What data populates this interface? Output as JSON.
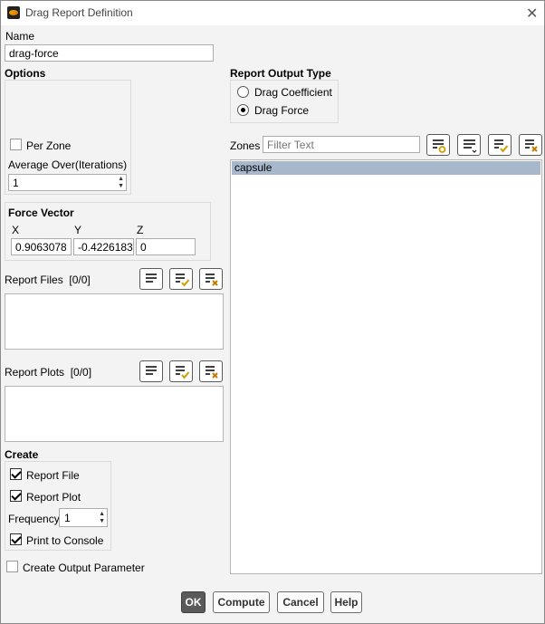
{
  "window": {
    "title": "Drag Report Definition"
  },
  "name": {
    "label": "Name",
    "value": "drag-force"
  },
  "options": {
    "heading": "Options",
    "per_zone": {
      "label": "Per Zone",
      "checked": false
    },
    "average_over": {
      "label": "Average Over(Iterations)",
      "value": "1"
    }
  },
  "force_vector": {
    "heading": "Force Vector",
    "x_label": "X",
    "y_label": "Y",
    "z_label": "Z",
    "x": "0.9063078",
    "y": "-0.4226183",
    "z": "0"
  },
  "report_files": {
    "label": "Report Files",
    "count": "[0/0]"
  },
  "report_plots": {
    "label": "Report Plots",
    "count": "[0/0]"
  },
  "create": {
    "heading": "Create",
    "report_file": {
      "label": "Report File",
      "checked": true
    },
    "report_plot": {
      "label": "Report Plot",
      "checked": true
    },
    "frequency": {
      "label": "Frequency",
      "value": "1"
    },
    "print_to_console": {
      "label": "Print to Console",
      "checked": true
    }
  },
  "create_output_parameter": {
    "label": "Create Output Parameter",
    "checked": false
  },
  "report_output_type": {
    "heading": "Report Output Type",
    "options": [
      "Drag Coefficient",
      "Drag Force"
    ],
    "selected": "Drag Force"
  },
  "zones": {
    "label": "Zones",
    "filter_placeholder": "Filter Text",
    "items": [
      "capsule"
    ],
    "selected": "capsule"
  },
  "buttons": {
    "ok": "OK",
    "compute": "Compute",
    "cancel": "Cancel",
    "help": "Help"
  },
  "icons": {
    "list": "list-icon",
    "select_all": "select-all-icon",
    "deselect_all": "deselect-all-icon",
    "match": "match-icon",
    "close": "close-icon",
    "app": "app-icon"
  },
  "colors": {
    "selection": "#a8b8cc",
    "ok_button": "#5a5a5a"
  }
}
